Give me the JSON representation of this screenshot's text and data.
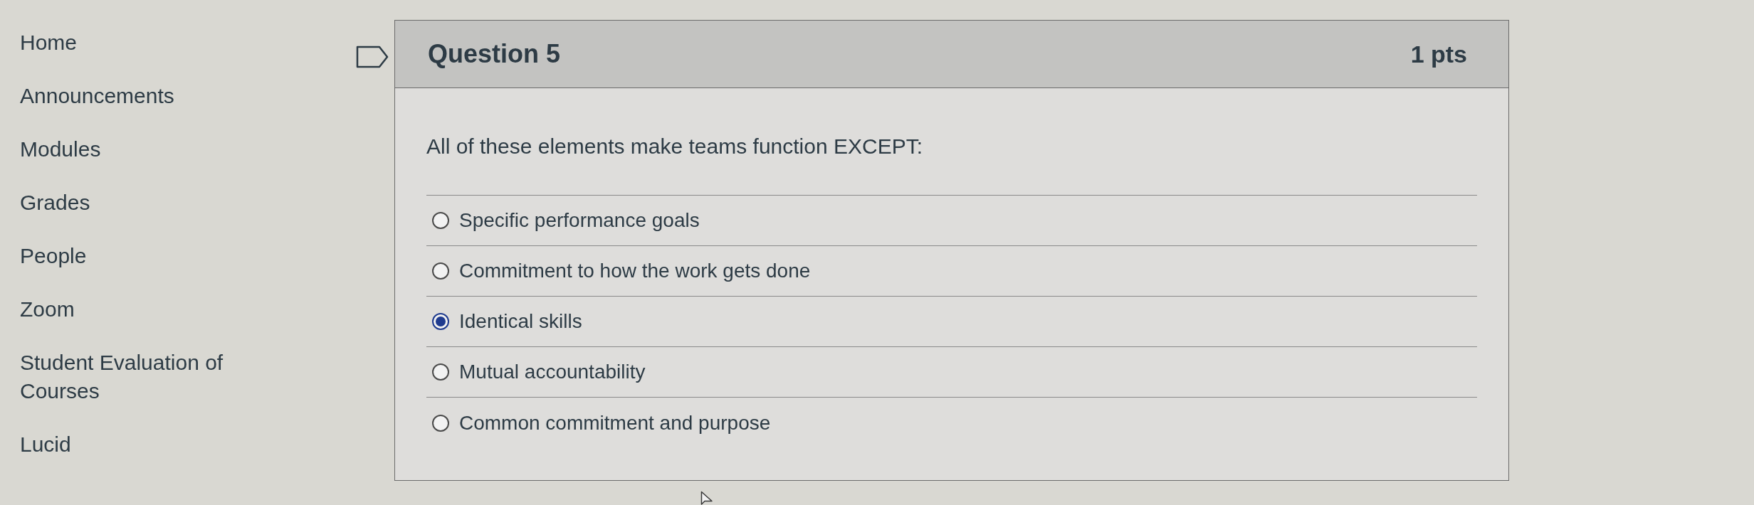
{
  "sidebar": {
    "items": [
      {
        "label": "Home"
      },
      {
        "label": "Announcements"
      },
      {
        "label": "Modules"
      },
      {
        "label": "Grades"
      },
      {
        "label": "People"
      },
      {
        "label": "Zoom"
      },
      {
        "label": "Student Evaluation of Courses"
      },
      {
        "label": "Lucid"
      }
    ]
  },
  "question": {
    "flagged": false,
    "title": "Question 5",
    "points": "1 pts",
    "prompt": "All of these elements make teams function EXCEPT:",
    "options": [
      {
        "label": "Specific performance goals",
        "selected": false
      },
      {
        "label": "Commitment to how the work gets done",
        "selected": false
      },
      {
        "label": "Identical skills",
        "selected": true
      },
      {
        "label": "Mutual accountability",
        "selected": false
      },
      {
        "label": "Common commitment and purpose",
        "selected": false
      }
    ]
  }
}
